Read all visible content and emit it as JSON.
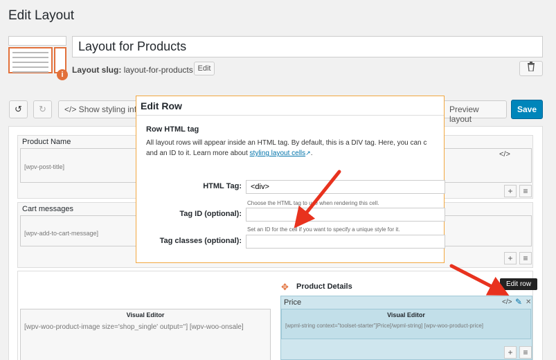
{
  "page": {
    "title": "Edit Layout"
  },
  "layout": {
    "name": "Layout for Products",
    "slug_label": "Layout slug:",
    "slug_value": "layout-for-products",
    "slug_edit": "Edit",
    "info": "i"
  },
  "toolbar": {
    "undo": "↺",
    "redo": "↻",
    "show_styling": "</> Show styling info",
    "preview": "Preview layout",
    "save": "Save"
  },
  "rows": [
    {
      "title": "Product Name",
      "shortcode": "[wpv-post-title]",
      "code_icon": "</>"
    },
    {
      "title": "Cart messages",
      "shortcode": "[wpv-add-to-cart-message]"
    }
  ],
  "visual_editor_left": {
    "title": "Visual Editor",
    "content": "[wpv-woo-product-image size='shop_single' output=''] [wpv-woo-onsale]"
  },
  "product_details": {
    "title": "Product Details",
    "price_label": "Price",
    "code_icon": "</>",
    "edit_icon": "✎",
    "close_icon": "✕",
    "visual_editor_title": "Visual Editor",
    "visual_editor_content": "[wpml-string context=\"toolset-starter\"]Price[/wpml-string] [wpv-woo-product-price]",
    "tooltip": "Edit row"
  },
  "controls": {
    "plus": "+",
    "menu": "≡"
  },
  "dialog": {
    "title": "Edit Row",
    "section": "Row HTML tag",
    "desc_line1": "All layout rows will appear inside an HTML tag. By default, this is a DIV tag. Here, you can c",
    "desc_line2_pre": "and an ID to it. Learn more about ",
    "desc_link": "styling layout cells",
    "desc_line2_post": ".",
    "html_tag_label": "HTML Tag:",
    "html_tag_value": "<div>",
    "html_tag_help": "Choose the HTML tag to use when rendering this cell.",
    "tag_id_label": "Tag ID (optional):",
    "tag_id_value": "",
    "tag_id_help": "Set an ID for the cell if you want to specify a unique style for it.",
    "tag_classes_label": "Tag classes (optional):",
    "tag_classes_value": ""
  },
  "colors": {
    "accent": "#0085ba",
    "highlight": "#e2703a",
    "arrow": "#e8321e",
    "dialog_border": "#f2a73f"
  }
}
